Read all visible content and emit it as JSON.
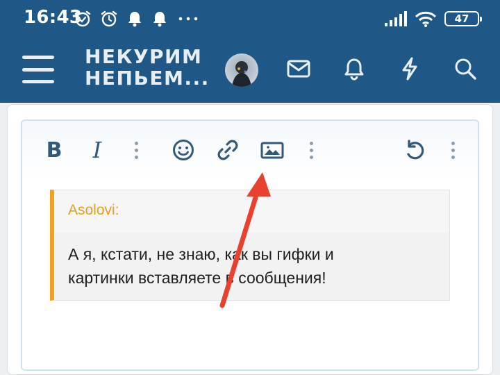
{
  "statusbar": {
    "time": "16:43",
    "battery": "47",
    "icons_left": [
      "alarm-icon",
      "alarm-icon",
      "notification-bell-icon",
      "notification-bell-icon",
      "more-dots-icon"
    ],
    "icons_right": [
      "signal-icon",
      "wifi-icon",
      "battery-icon"
    ]
  },
  "header": {
    "logo_line1": "НЕКУРИМ",
    "logo_line2": "НЕПЬЕМ...",
    "icons": [
      "menu-icon",
      "avatar",
      "mail-icon",
      "bell-icon",
      "lightning-icon",
      "search-icon"
    ]
  },
  "toolbar": {
    "bold_label": "B",
    "italic_label": "I",
    "buttons": [
      "bold",
      "italic",
      "more",
      "emoji",
      "link",
      "image",
      "more",
      "undo",
      "more"
    ]
  },
  "quote": {
    "author": "Asolovi:",
    "line1": "А я, кстати, не знаю, как вы гифки и",
    "line2": "картинки вставляете в сообщения!"
  },
  "colors": {
    "header_bg": "#1f5886",
    "quote_accent": "#f0a21e",
    "annotation_arrow": "#e8412d",
    "icon_color": "#32587a"
  }
}
